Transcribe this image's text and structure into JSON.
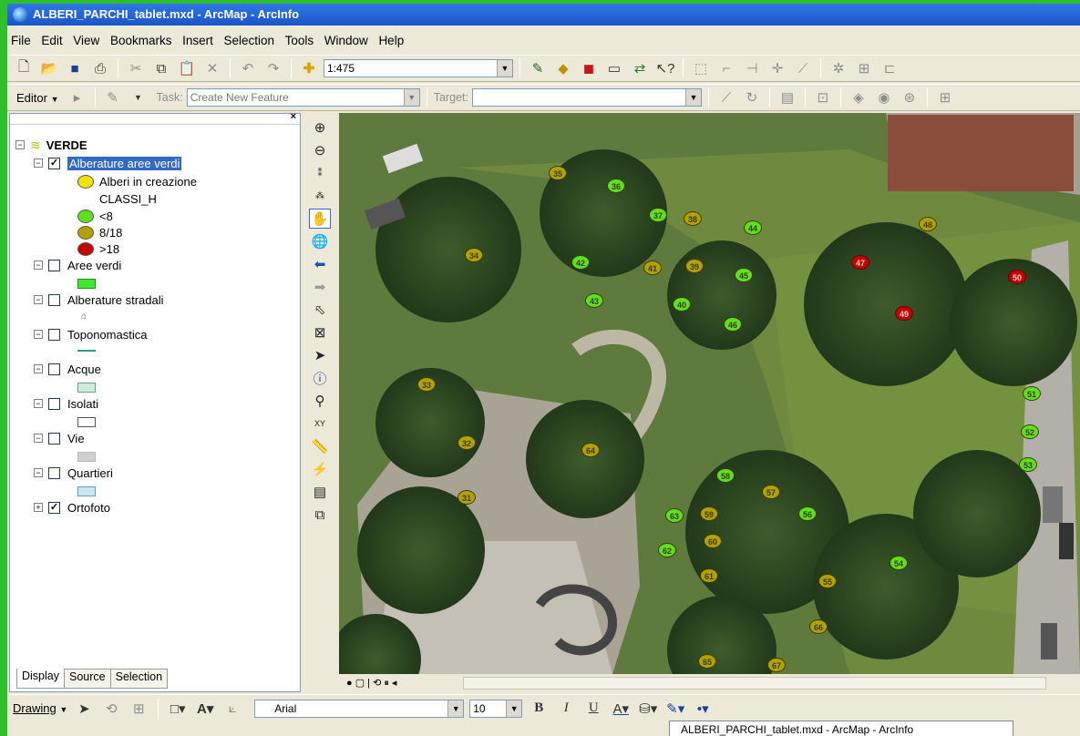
{
  "window": {
    "title": "ALBERI_PARCHI_tablet.mxd - ArcMap - ArcInfo"
  },
  "menu": [
    "File",
    "Edit",
    "View",
    "Bookmarks",
    "Insert",
    "Selection",
    "Tools",
    "Window",
    "Help"
  ],
  "toolbar": {
    "scale": "1:475"
  },
  "editor": {
    "label": "Editor",
    "task_label": "Task:",
    "task_value": "Create New Feature",
    "target_label": "Target:"
  },
  "toc": {
    "group": "VERDE",
    "layers": [
      {
        "label": "Alberature aree verdi",
        "checked": true
      },
      {
        "label": "Alberi in creazione"
      },
      {
        "label": "CLASSI_H"
      },
      {
        "label": "<8"
      },
      {
        "label": "8/18"
      },
      {
        "label": ">18"
      },
      {
        "label": "Aree verdi",
        "checked": false
      },
      {
        "label": "Alberature stradali",
        "checked": false
      },
      {
        "label": "Toponomastica",
        "checked": false
      },
      {
        "label": "Acque",
        "checked": false
      },
      {
        "label": "Isolati",
        "checked": false
      },
      {
        "label": "Vie",
        "checked": false
      },
      {
        "label": "Quartieri",
        "checked": false
      },
      {
        "label": "Ortofoto",
        "checked": true
      }
    ],
    "tabs": [
      "Display",
      "Source",
      "Selection"
    ]
  },
  "colors": {
    "lt8": "#5de01e",
    "mid": "#b3a100",
    "gt18": "#c60000",
    "creation": "#f2e200"
  },
  "map": {
    "trees": [
      {
        "id": "35",
        "cls": "mid"
      },
      {
        "id": "36",
        "cls": "lt8"
      },
      {
        "id": "37",
        "cls": "lt8"
      },
      {
        "id": "38",
        "cls": "mid"
      },
      {
        "id": "44",
        "cls": "lt8"
      },
      {
        "id": "48",
        "cls": "mid"
      },
      {
        "id": "34",
        "cls": "mid"
      },
      {
        "id": "42",
        "cls": "lt8"
      },
      {
        "id": "41",
        "cls": "mid"
      },
      {
        "id": "39",
        "cls": "mid"
      },
      {
        "id": "45",
        "cls": "lt8"
      },
      {
        "id": "47",
        "cls": "gt18"
      },
      {
        "id": "50",
        "cls": "gt18"
      },
      {
        "id": "43",
        "cls": "lt8"
      },
      {
        "id": "40",
        "cls": "lt8"
      },
      {
        "id": "49",
        "cls": "gt18"
      },
      {
        "id": "46",
        "cls": "lt8"
      },
      {
        "id": "33",
        "cls": "mid"
      },
      {
        "id": "51",
        "cls": "lt8"
      },
      {
        "id": "52",
        "cls": "lt8"
      },
      {
        "id": "32",
        "cls": "mid"
      },
      {
        "id": "64",
        "cls": "mid"
      },
      {
        "id": "53",
        "cls": "lt8"
      },
      {
        "id": "58",
        "cls": "lt8"
      },
      {
        "id": "57",
        "cls": "mid"
      },
      {
        "id": "31",
        "cls": "mid"
      },
      {
        "id": "63",
        "cls": "lt8"
      },
      {
        "id": "59",
        "cls": "mid"
      },
      {
        "id": "56",
        "cls": "lt8"
      },
      {
        "id": "60",
        "cls": "mid"
      },
      {
        "id": "62",
        "cls": "lt8"
      },
      {
        "id": "54",
        "cls": "lt8"
      },
      {
        "id": "61",
        "cls": "mid"
      },
      {
        "id": "55",
        "cls": "mid"
      },
      {
        "id": "66",
        "cls": "mid"
      },
      {
        "id": "65",
        "cls": "mid"
      },
      {
        "id": "67",
        "cls": "mid"
      }
    ]
  },
  "drawing": {
    "label": "Drawing",
    "font": "Arial",
    "size": "10"
  },
  "statusbar": {
    "text": "ALBERI_PARCHI_tablet.mxd - ArcMap - ArcInfo"
  }
}
